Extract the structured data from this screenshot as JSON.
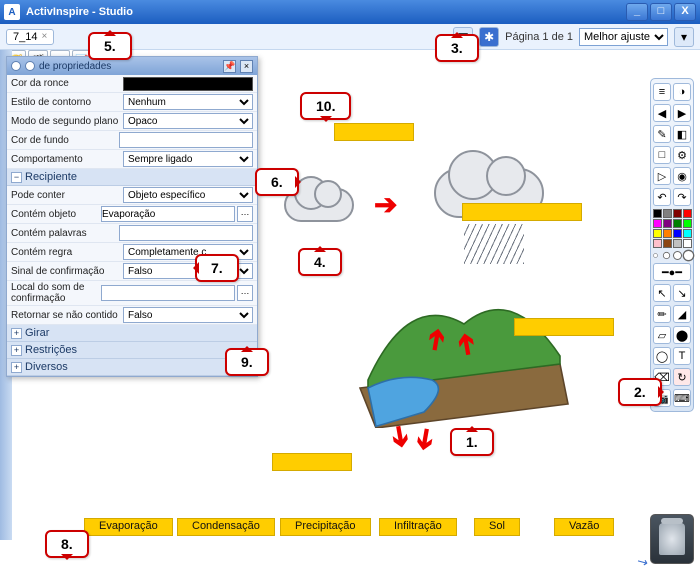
{
  "window": {
    "title": "ActivInspire - Studio",
    "minimize": "_",
    "maximize": "□",
    "close": "X"
  },
  "toptool": {
    "tab_name": "7_14",
    "tab_close": "×",
    "page_indicator": "Página 1 de 1",
    "zoom_selected": "Melhor ajuste"
  },
  "properties_panel": {
    "title": "de propriedades",
    "rows": {
      "cor_fonte": "Cor da ronce",
      "estilo_contorno_l": "Estilo de contorno",
      "estilo_contorno_v": "Nenhum",
      "modo_seg_l": "Modo de segundo plano",
      "modo_seg_v": "Opaco",
      "cor_fundo_l": "Cor de fundo",
      "comportamento_l": "Comportamento",
      "comportamento_v": "Sempre ligado"
    },
    "section_recipiente": "Recipiente",
    "recipiente": {
      "pode_conter_l": "Pode conter",
      "pode_conter_v": "Objeto específico",
      "contem_objeto_l": "Contém objeto",
      "contem_objeto_v": "Evaporação",
      "contem_palavras_l": "Contém palavras",
      "contem_regra_l": "Contém regra",
      "contem_regra_v": "Completamente c",
      "sinal_conf_l": "Sinal de confirmação",
      "sinal_conf_v": "Falso",
      "local_som_l": "Local do som de confirmação",
      "retornar_l": "Retornar se não contido",
      "retornar_v": "Falso"
    },
    "section_girar": "Girar",
    "section_restricoes": "Restrições",
    "section_diversos": "Diversos"
  },
  "labels_bank": {
    "w1": "Evaporação",
    "w2": "Condensação",
    "w3": "Precipitação",
    "w4": "Infiltração",
    "w5": "Sol",
    "w6": "Vazão"
  },
  "callouts": {
    "c1": "1.",
    "c2": "2.",
    "c3": "3.",
    "c4": "4.",
    "c5": "5.",
    "c6": "6.",
    "c7": "7.",
    "c8": "8.",
    "c9": "9.",
    "c10": "10."
  },
  "swatches": [
    "#000000",
    "#808080",
    "#800000",
    "#ff0000",
    "#ff00ff",
    "#800080",
    "#008000",
    "#00ff00",
    "#ffff00",
    "#ff8000",
    "#0000ff",
    "#00ffff",
    "#ffc0cb",
    "#8b4513",
    "#c0c0c0",
    "#ffffff"
  ]
}
